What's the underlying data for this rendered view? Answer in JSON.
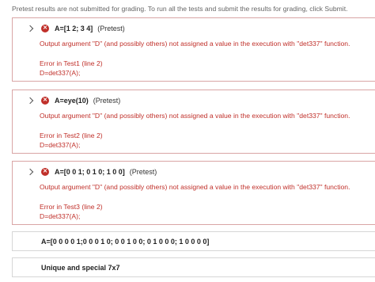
{
  "notice": "Pretest results are not submitted for grading. To run all the tests and submit the results for grading, click Submit.",
  "tests": [
    {
      "name": "A=[1 2; 3 4]",
      "tag": "(Pretest)",
      "message": "Output argument \"D\" (and possibly others) not assigned a value in the execution with \"det337\" function.",
      "location": "Error in Test1 (line 2)",
      "code": "D=det337(A);"
    },
    {
      "name": "A=eye(10)",
      "tag": "(Pretest)",
      "message": "Output argument \"D\" (and possibly others) not assigned a value in the execution with \"det337\" function.",
      "location": "Error in Test2 (line 2)",
      "code": "D=det337(A);"
    },
    {
      "name": "A=[0 0 1; 0 1 0; 1 0 0]",
      "tag": "(Pretest)",
      "message": "Output argument \"D\" (and possibly others) not assigned a value in the execution with \"det337\" function.",
      "location": "Error in Test3 (line 2)",
      "code": "D=det337(A);"
    }
  ],
  "extra_tests": [
    {
      "name": "A=[0 0 0 0 1;0 0 0 1 0; 0 0 1 0 0; 0 1 0 0 0; 1 0 0 0 0]"
    },
    {
      "name": "Unique and special 7x7"
    }
  ],
  "icons": {
    "expand": "chevron-right-icon",
    "fail": "x-circle-icon"
  },
  "colors": {
    "error": "#c0302a",
    "fail_border": "#d9a5a5",
    "neutral_border": "#d6d6d6"
  }
}
